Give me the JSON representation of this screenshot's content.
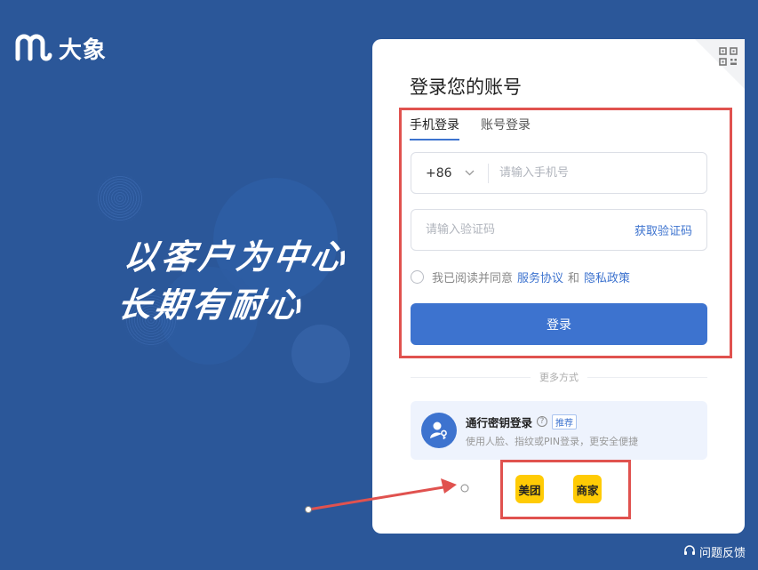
{
  "brand": {
    "name": "大象",
    "icon": "dx-logo-icon"
  },
  "slogan": {
    "line1": "以客户为中心",
    "line2": "长期有耐心"
  },
  "login": {
    "title": "登录您的账号",
    "tabs": [
      {
        "label": "手机登录",
        "active": true
      },
      {
        "label": "账号登录",
        "active": false
      }
    ],
    "country_code": "+86",
    "phone_placeholder": "请输入手机号",
    "code_placeholder": "请输入验证码",
    "get_code_label": "获取验证码",
    "agreement": {
      "prefix": "我已阅读并同意",
      "service_link": "服务协议",
      "and": "和",
      "privacy_link": "隐私政策"
    },
    "submit_label": "登录",
    "more_ways": "更多方式",
    "passkey": {
      "title": "通行密钥登录",
      "badge": "推荐",
      "desc": "使用人脸、指纹或PIN登录，更安全便捷"
    },
    "alt_logins": [
      {
        "label": "美团"
      },
      {
        "label": "商家"
      }
    ]
  },
  "feedback_label": "问题反馈",
  "colors": {
    "background": "#2b5799",
    "accent": "#3d73cf",
    "highlight": "#e0524f",
    "meituan_yellow": "#ffcb05"
  }
}
